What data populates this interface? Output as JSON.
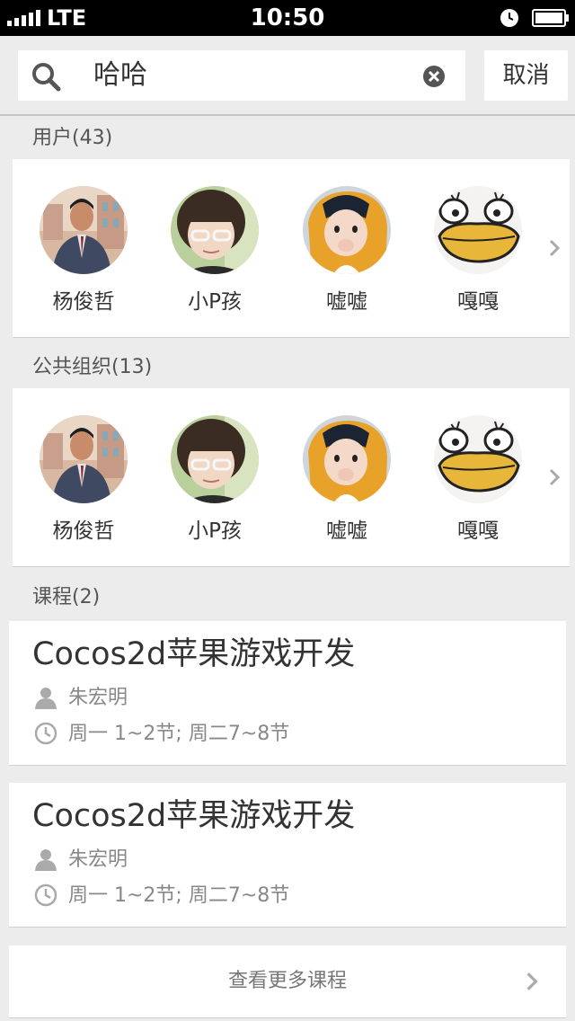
{
  "status_bar": {
    "carrier": "LTE",
    "time": "10:50",
    "icons": [
      "signal-icon",
      "alarm-icon",
      "battery-icon"
    ]
  },
  "search": {
    "query": "哈哈",
    "cancel_label": "取消",
    "icons": [
      "search-icon",
      "clear-icon"
    ]
  },
  "users": {
    "title": "用户(43)",
    "items": [
      {
        "name": "杨俊哲",
        "avatar": "man-photo"
      },
      {
        "name": "小P孩",
        "avatar": "girl-photo"
      },
      {
        "name": "嘘嘘",
        "avatar": "child-photo"
      },
      {
        "name": "嘎嘎",
        "avatar": "duck-cartoon"
      }
    ]
  },
  "orgs": {
    "title": "公共组织(13)",
    "items": [
      {
        "name": "杨俊哲",
        "avatar": "man-photo"
      },
      {
        "name": "小P孩",
        "avatar": "girl-photo"
      },
      {
        "name": "嘘嘘",
        "avatar": "child-photo"
      },
      {
        "name": "嘎嘎",
        "avatar": "duck-cartoon"
      }
    ]
  },
  "courses": {
    "title": "课程(2)",
    "items": [
      {
        "title": "Cocos2d苹果游戏开发",
        "teacher": "朱宏明",
        "schedule": "周一 1~2节; 周二7~8节"
      },
      {
        "title": "Cocos2d苹果游戏开发",
        "teacher": "朱宏明",
        "schedule": "周一 1~2节; 周二7~8节"
      }
    ],
    "more_label": "查看更多课程"
  },
  "colors": {
    "background": "#ececec",
    "card": "#ffffff",
    "text": "#333333",
    "muted": "#888888",
    "status_bar": "#000000"
  }
}
